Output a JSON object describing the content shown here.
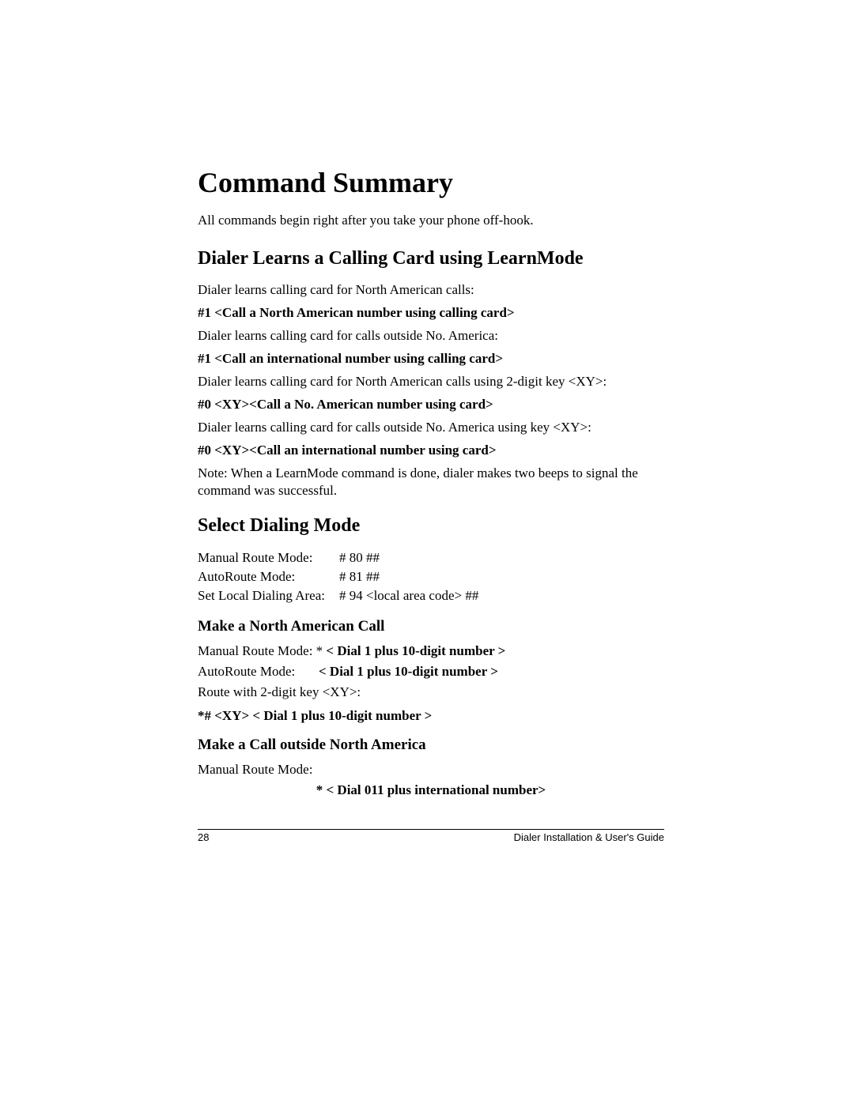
{
  "title": "Command Summary",
  "intro": "All commands begin right after you take your phone off-hook.",
  "section1": {
    "heading": "Dialer Learns a Calling Card using LearnMode",
    "p1": "Dialer learns calling card for North American calls:",
    "cmd1": "#1 <Call a North American number using calling card>",
    "p2": "Dialer learns calling card for calls outside No. America:",
    "cmd2": "#1 <Call an international number using calling card>",
    "p3": "Dialer learns calling card for North American calls using 2-digit key <XY>:",
    "cmd3": "#0 <XY><Call a No. American number using card>",
    "p4": "Dialer learns calling card for calls outside No. America using key <XY>:",
    "cmd4": "#0 <XY><Call an international number using card>",
    "note": "Note: When a LearnMode command is done, dialer makes two beeps to signal the command was successful."
  },
  "section2": {
    "heading": "Select Dialing Mode",
    "rows": [
      {
        "label": "Manual Route Mode:",
        "code": "# 80 ##"
      },
      {
        "label": "AutoRoute Mode:",
        "code": "# 81 ##"
      },
      {
        "label": "Set Local Dialing Area:",
        "code": "# 94 <local area code> ##"
      }
    ]
  },
  "section3": {
    "heading": "Make a North American Call",
    "l1_label": "Manual Route Mode:  * ",
    "l1_bold": "< Dial 1 plus 10-digit number >",
    "l2_label": "AutoRoute Mode:       ",
    "l2_bold": "< Dial 1 plus 10-digit number >",
    "l3": "Route with 2-digit key <XY>:",
    "l3_bold": " *# <XY> < Dial 1 plus 10-digit number >"
  },
  "section4": {
    "heading": "Make a Call outside North America",
    "l1": "Manual Route Mode:",
    "bold": "* < Dial 011 plus international number>"
  },
  "footer": {
    "page": "28",
    "doc": "Dialer Installation & User's Guide"
  }
}
